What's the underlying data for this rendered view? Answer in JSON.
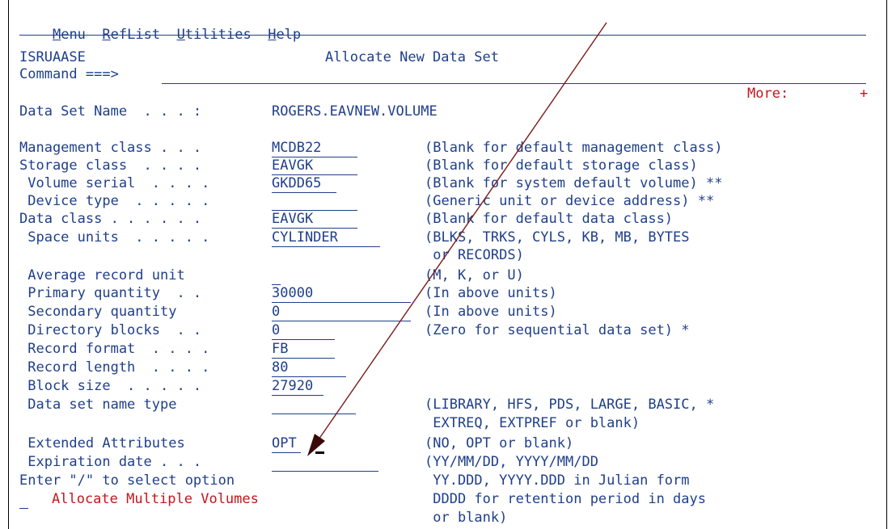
{
  "menu": [
    {
      "mnemonic": "M",
      "rest": "enu"
    },
    {
      "mnemonic": "R",
      "rest": "efList"
    },
    {
      "mnemonic": "U",
      "rest": "tilities"
    },
    {
      "mnemonic": "H",
      "rest": "elp"
    }
  ],
  "panel_id": "ISRUAASE",
  "title": "Allocate New Data Set",
  "command_label": "Command ===>",
  "more_label": "More:",
  "more_indicator": "+",
  "dsn_label": "Data Set Name  . . . :",
  "dsn_value": "ROGERS.EAVNEW.VOLUME",
  "fields": {
    "mgmt_class": {
      "label": "Management class . . .",
      "value": "MCDB22"
    },
    "storage_class": {
      "label": "Storage class  . . . .",
      "value": "EAVGK"
    },
    "volume_serial": {
      "label": " Volume serial  . . . .",
      "value": "GKDD65"
    },
    "device_type": {
      "label": " Device type  . . . . .",
      "value": ""
    },
    "data_class": {
      "label": "Data class . . . . . .",
      "value": "EAVGK"
    },
    "space_units": {
      "label": " Space units  . . . . .",
      "value": "CYLINDER"
    },
    "avg_rec_unit": {
      "label": " Average record unit",
      "value": ""
    },
    "primary": {
      "label": " Primary quantity  . .",
      "value": "30000"
    },
    "secondary": {
      "label": " Secondary quantity",
      "value": "0"
    },
    "dir_blocks": {
      "label": " Directory blocks  . .",
      "value": "0"
    },
    "rec_format": {
      "label": " Record format  . . . .",
      "value": "FB"
    },
    "rec_length": {
      "label": " Record length  . . . .",
      "value": "80"
    },
    "block_size": {
      "label": " Block size  . . . . .",
      "value": "27920"
    },
    "dsn_type": {
      "label": " Data set name type",
      "value": ""
    },
    "ext_attr": {
      "label": " Extended Attributes",
      "value": "OPT"
    },
    "exp_date": {
      "label": " Expiration date . . .",
      "value": ""
    }
  },
  "help": {
    "mgmt_class": "(Blank for default management class)",
    "storage_class": "(Blank for default storage class)",
    "volume_serial": "(Blank for system default volume) **",
    "device_type": "(Generic unit or device address) **",
    "data_class": "(Blank for default data class)",
    "space_units_1": "(BLKS, TRKS, CYLS, KB, MB, BYTES",
    "space_units_2": " or RECORDS)",
    "avg_rec_unit": "(M, K, or U)",
    "primary": "(In above units)",
    "secondary": "(In above units)",
    "dir_blocks": "(Zero for sequential data set) *",
    "dsn_type_1": "(LIBRARY, HFS, PDS, LARGE, BASIC, *",
    "dsn_type_2": " EXTREQ, EXTPREF or blank)",
    "ext_attr": "(NO, OPT or blank)",
    "exp_date_1": "(YY/MM/DD, YYYY/MM/DD",
    "exp_date_2": " YY.DDD, YYYY.DDD in Julian form",
    "exp_date_3": " DDDD for retention period in days",
    "exp_date_4": " or blank)"
  },
  "select_prompt": "Enter \"/\" to select option",
  "option_label": "Allocate Multiple Volumes",
  "colors": {
    "text": "#1f3f8a",
    "option": "#c4161c",
    "arrow": "#7a1a1a"
  }
}
